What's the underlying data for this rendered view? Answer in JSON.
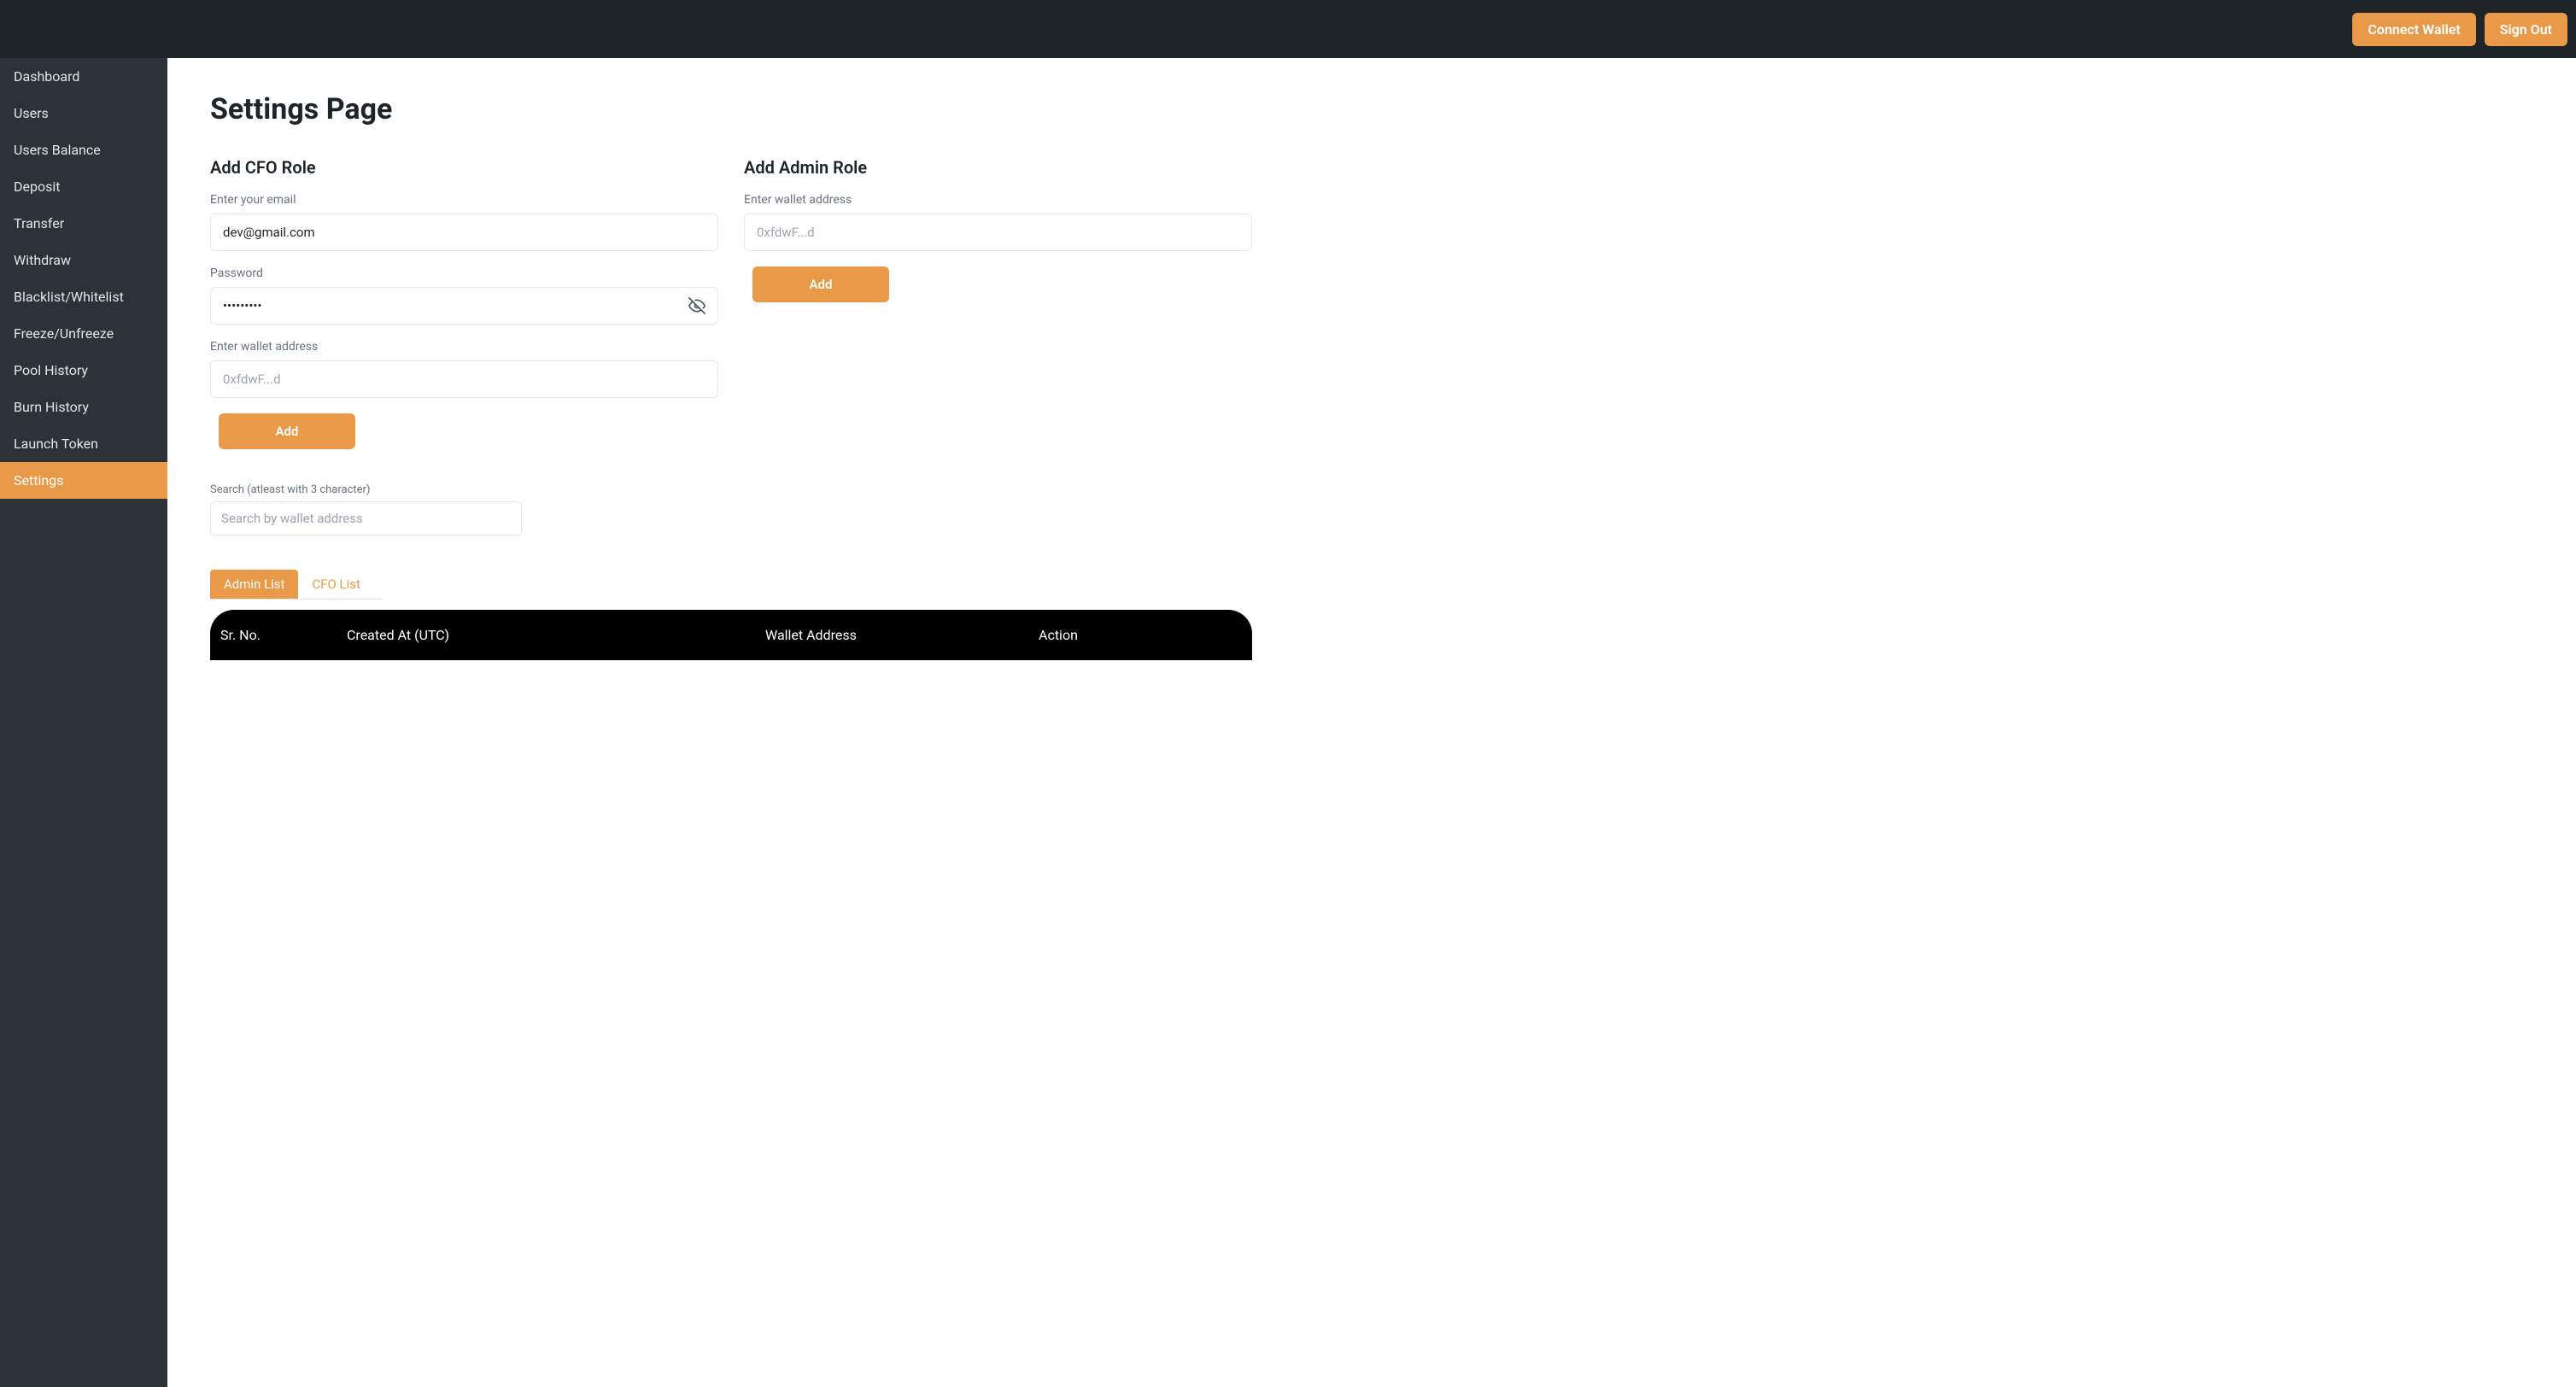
{
  "header": {
    "connect_wallet": "Connect Wallet",
    "sign_out": "Sign Out"
  },
  "sidebar": {
    "items": [
      {
        "label": "Dashboard",
        "active": false
      },
      {
        "label": "Users",
        "active": false
      },
      {
        "label": "Users Balance",
        "active": false
      },
      {
        "label": "Deposit",
        "active": false
      },
      {
        "label": "Transfer",
        "active": false
      },
      {
        "label": "Withdraw",
        "active": false
      },
      {
        "label": "Blacklist/Whitelist",
        "active": false
      },
      {
        "label": "Freeze/Unfreeze",
        "active": false
      },
      {
        "label": "Pool History",
        "active": false
      },
      {
        "label": "Burn History",
        "active": false
      },
      {
        "label": "Launch Token",
        "active": false
      },
      {
        "label": "Settings",
        "active": true
      }
    ]
  },
  "page": {
    "title": "Settings Page"
  },
  "cfo_section": {
    "title": "Add CFO Role",
    "email_label": "Enter your email",
    "email_value": "dev@gmail.com",
    "password_label": "Password",
    "password_value": "•••••••••",
    "wallet_label": "Enter wallet address",
    "wallet_placeholder": "0xfdwF...d",
    "add_button": "Add"
  },
  "admin_section": {
    "title": "Add Admin Role",
    "wallet_label": "Enter wallet address",
    "wallet_placeholder": "0xfdwF...d",
    "add_button": "Add"
  },
  "search": {
    "label": "Search (atleast with 3 character)",
    "placeholder": "Search by wallet address"
  },
  "tabs": {
    "admin_list": "Admin List",
    "cfo_list": "CFO List"
  },
  "table": {
    "headers": {
      "sr_no": "Sr. No.",
      "created_at": "Created At (UTC)",
      "wallet_address": "Wallet Address",
      "action": "Action"
    }
  },
  "colors": {
    "accent": "#e89a49",
    "topbar": "#1f2429",
    "sidebar": "#2c3238"
  }
}
